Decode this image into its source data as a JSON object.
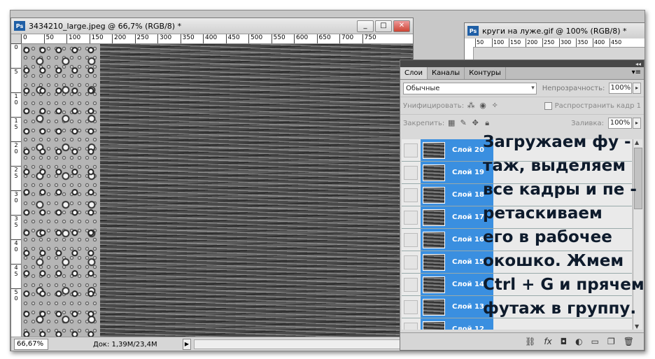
{
  "doc_window": {
    "title": "3434210_large.jpeg @ 66,7% (RGB/8) *",
    "ruler_h": [
      "0",
      "50",
      "100",
      "150",
      "200",
      "250",
      "300",
      "350",
      "400",
      "450",
      "500",
      "550",
      "600",
      "650",
      "700",
      "750"
    ],
    "ruler_v": [
      "0",
      "5",
      "1\n0",
      "1\n5",
      "2\n0",
      "2\n5",
      "3\n0",
      "3\n5",
      "4\n0",
      "4\n5",
      "5\n0"
    ],
    "minimize": "_",
    "maximize": "□",
    "close": "✕",
    "zoom": "66,67%",
    "doc_size": "Док: 1,39M/23,4M"
  },
  "second_window": {
    "title": "круги на луже.gif @ 100% (RGB/8) *",
    "ruler": [
      "50",
      "100",
      "150",
      "200",
      "250",
      "300",
      "350",
      "400",
      "450"
    ]
  },
  "layers_panel": {
    "tabs": [
      "Слои",
      "Каналы",
      "Контуры"
    ],
    "blend_mode": "Обычные",
    "opacity_label": "Непрозрачность:",
    "opacity_value": "100%",
    "unify_label": "Унифицировать:",
    "propagate_label": "Распространить кадр 1",
    "lock_label": "Закрепить:",
    "fill_label": "Заливка:",
    "fill_value": "100%",
    "layers": [
      "Слой 20",
      "Слой 19",
      "Слой 18",
      "Слой 17",
      "Слой 16",
      "Слой 15",
      "Слой 14",
      "Слой 13",
      "Слой 12"
    ]
  },
  "overlay_text": [
    "Загружаем фу -",
    "таж, выделяем",
    "все кадры и пе -",
    "ретаскиваем",
    "его в рабочее",
    "окошко. Жмем",
    "Ctrl + G и прячем",
    "футаж в группу."
  ],
  "colors": {
    "layer_selected": "#3a8fe0",
    "ps_logo": "#1f5fa6"
  },
  "icons": [
    "photoshop-logo-icon",
    "link-icon",
    "fx-icon",
    "mask-icon",
    "adjustment-icon",
    "folder-icon",
    "new-layer-icon",
    "trash-icon"
  ]
}
